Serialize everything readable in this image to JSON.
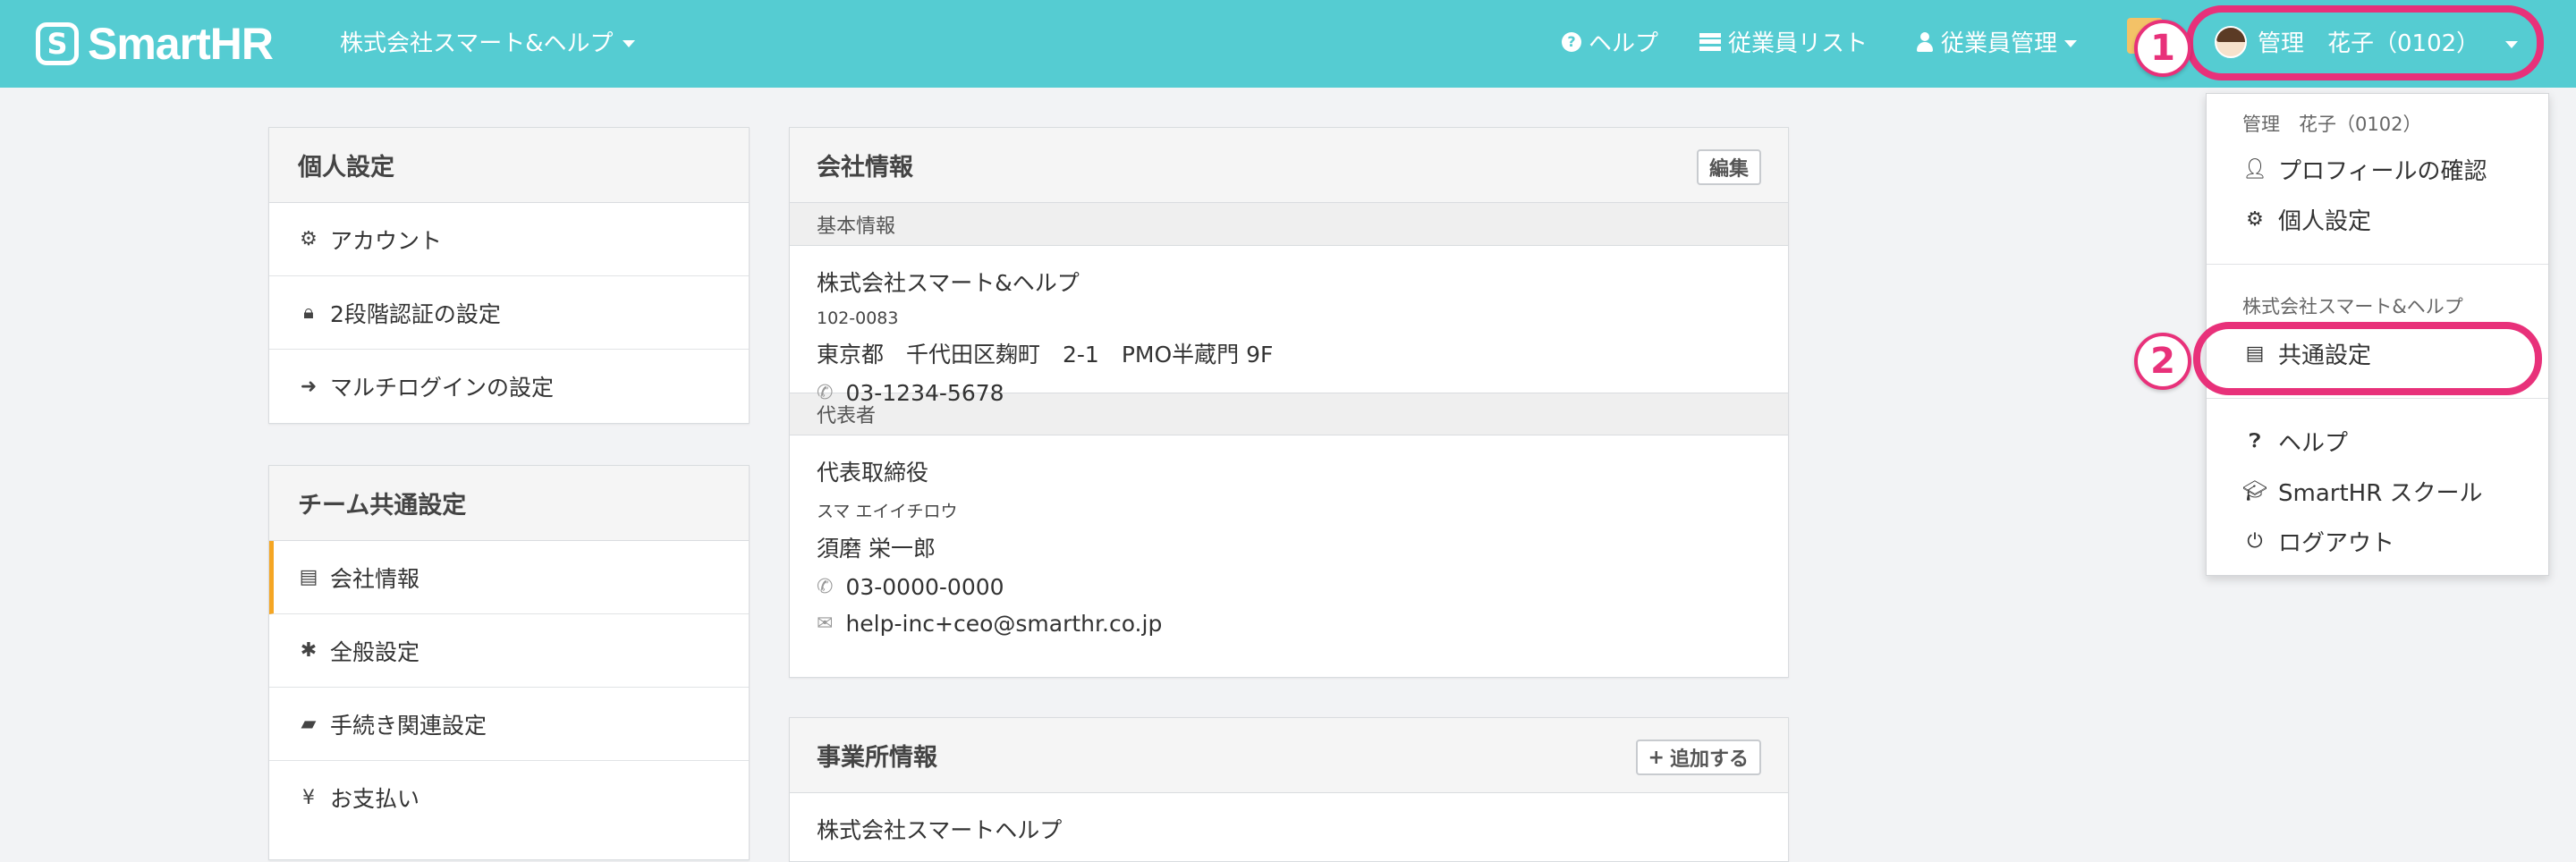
{
  "brand": {
    "logo_text": "SmartHR",
    "logo_mark": "S"
  },
  "header": {
    "company_name": "株式会社スマート&ヘルプ",
    "nav": {
      "help": "ヘルプ",
      "employee_list": "従業員リスト",
      "employee_management": "従業員管理"
    },
    "user_name": "管理　花子（0102）"
  },
  "annotations": {
    "step1": "1",
    "step2": "2"
  },
  "colors": {
    "header": "#55ccd2",
    "highlight": "#e8317a",
    "active_bar": "#f5a623"
  },
  "personal_settings": {
    "title": "個人設定",
    "items": [
      "アカウント",
      "2段階認証の設定",
      "マルチログインの設定"
    ]
  },
  "team_settings": {
    "title": "チーム共通設定",
    "items": [
      "会社情報",
      "全般設定",
      "手続き関連設定",
      "お支払い"
    ]
  },
  "company_info": {
    "title": "会社情報",
    "edit_label": "編集",
    "basic_label": "基本情報",
    "company_name": "株式会社スマート&ヘルプ",
    "postal": "102-0083",
    "address": "東京都　千代田区麹町　2-1　PMO半蔵門 9F",
    "phone": "03-1234-5678",
    "rep_label": "代表者",
    "rep_title": "代表取締役",
    "rep_kana": "スマ エイイチロウ",
    "rep_name": "須磨 栄一郎",
    "rep_phone": "03-0000-0000",
    "rep_email": "help-inc+ceo@smarthr.co.jp"
  },
  "office_info": {
    "title": "事業所情報",
    "add_label": "追加する",
    "first_office": "株式会社スマートヘルプ"
  },
  "dropdown": {
    "user_label": "管理　花子（0102）",
    "profile": "プロフィールの確認",
    "personal": "個人設定",
    "company_label": "株式会社スマート&ヘルプ",
    "common_settings": "共通設定",
    "help": "ヘルプ",
    "school": "SmartHR スクール",
    "logout": "ログアウト"
  }
}
